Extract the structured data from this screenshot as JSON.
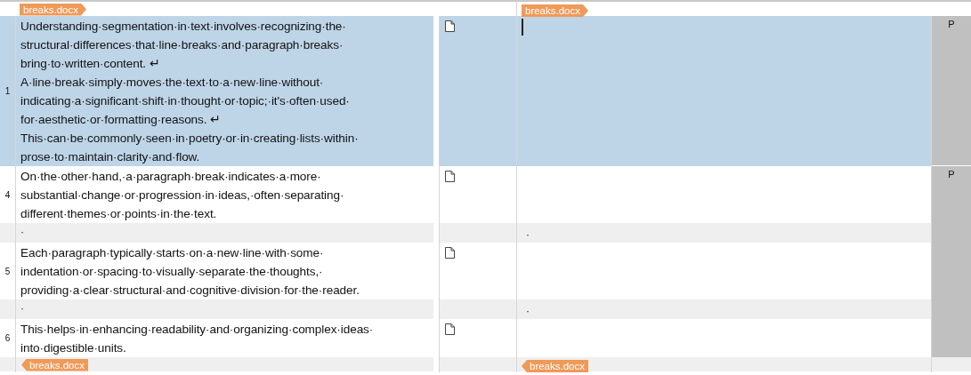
{
  "rows": [
    {
      "kind": "tags",
      "source_tag": {
        "label": "breaks.docx",
        "kind": "open"
      },
      "target_tag": {
        "label": "breaks.docx",
        "kind": "open"
      }
    },
    {
      "kind": "segment",
      "number": "1",
      "selected": true,
      "cursor": true,
      "status": "P",
      "source_lines": [
        "Understanding·segmentation·in·text·involves·recognizing·the·",
        "structural·differences·that·line·breaks·and·paragraph·breaks·",
        "bring·to·written·content. ↵",
        "A·line·break·simply·moves·the·text·to·a·new·line·without·",
        "indicating·a·significant·shift·in·thought·or·topic;·it's·often·used·",
        "for·aesthetic·or·formatting·reasons. ↵",
        "This·can·be·commonly·seen·in·poetry·or·in·creating·lists·within·",
        "prose·to·maintain·clarity·and·flow."
      ]
    },
    {
      "kind": "segment",
      "number": "4",
      "selected": false,
      "cursor": false,
      "status": "P",
      "source_lines": [
        "On·the·other·hand,·a·paragraph·break·indicates·a·more·",
        "substantial·change·or·progression·in·ideas,·often·separating·",
        "different·themes·or·points·in·the·text."
      ]
    },
    {
      "kind": "spacer",
      "source": "·",
      "target": "·"
    },
    {
      "kind": "segment",
      "number": "5",
      "selected": false,
      "cursor": false,
      "source_lines": [
        "Each·paragraph·typically·starts·on·a·new·line·with·some·",
        "indentation·or·spacing·to·visually·separate·the·thoughts,·",
        "providing·a·clear·structural·and·cognitive·division·for·the·reader."
      ]
    },
    {
      "kind": "spacer",
      "source": "·",
      "target": "·"
    },
    {
      "kind": "segment",
      "number": "6",
      "selected": false,
      "cursor": false,
      "source_lines": [
        "This·helps·in·enhancing·readability·and·organizing·complex·ideas·",
        "into·digestible·units."
      ]
    },
    {
      "kind": "tags",
      "source_tag": {
        "label": "breaks.docx",
        "kind": "close"
      },
      "target_tag": {
        "label": "breaks.docx",
        "kind": "close"
      }
    }
  ]
}
